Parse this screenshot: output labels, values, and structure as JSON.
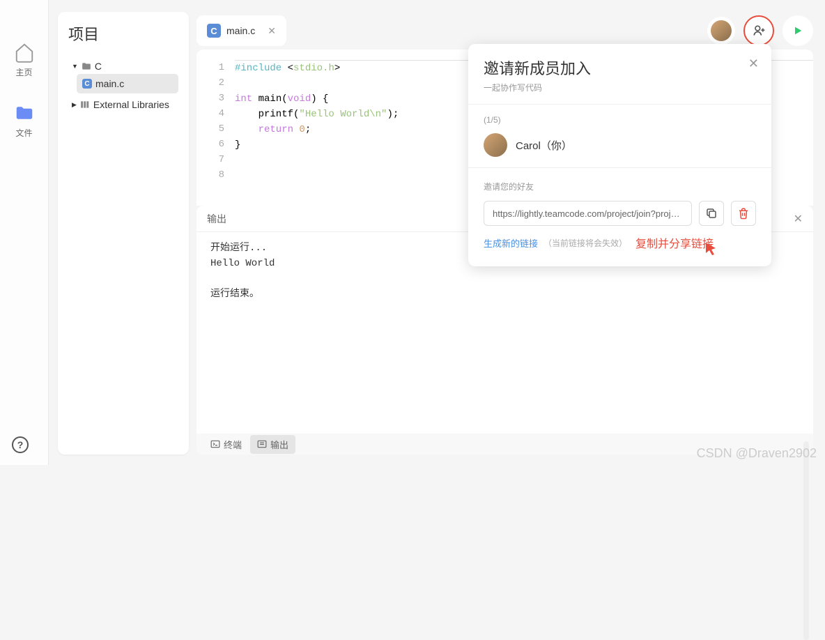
{
  "nav": {
    "items": [
      {
        "label": "主页"
      },
      {
        "label": "文件"
      }
    ]
  },
  "project": {
    "title": "项目",
    "root": "C",
    "file": "main.c",
    "ext_libs": "External Libraries"
  },
  "editor": {
    "tab": {
      "icon": "C",
      "label": "main.c"
    },
    "lines": [
      "1",
      "2",
      "3",
      "4",
      "5",
      "6",
      "7",
      "8"
    ],
    "code": {
      "l1_include": "#include",
      "l1_header": "stdio.h",
      "l3_int": "int",
      "l3_main": " main(",
      "l3_void": "void",
      "l3_rest": ") {",
      "l4_printf": "    printf(",
      "l4_str": "\"Hello World\\n\"",
      "l4_end": ");",
      "l5_return": "    return ",
      "l5_zero": "0",
      "l5_semi": ";",
      "l6_brace": "}"
    }
  },
  "output": {
    "title": "输出",
    "body": "开始运行...\nHello World\n\n运行结束。"
  },
  "bottom_tabs": {
    "terminal": "终端",
    "output": "输出"
  },
  "dialog": {
    "title": "邀请新成员加入",
    "subtitle": "一起协作写代码",
    "member_count": "(1/5)",
    "member_name": "Carol（你）",
    "invite_label": "邀请您的好友",
    "invite_url": "https://lightly.teamcode.com/project/join?projectI...",
    "gen_link": "生成新的链接",
    "link_note": "（当前链接将会失效）",
    "copy_share": "复制并分享链接"
  },
  "watermark": "CSDN @Draven2902"
}
